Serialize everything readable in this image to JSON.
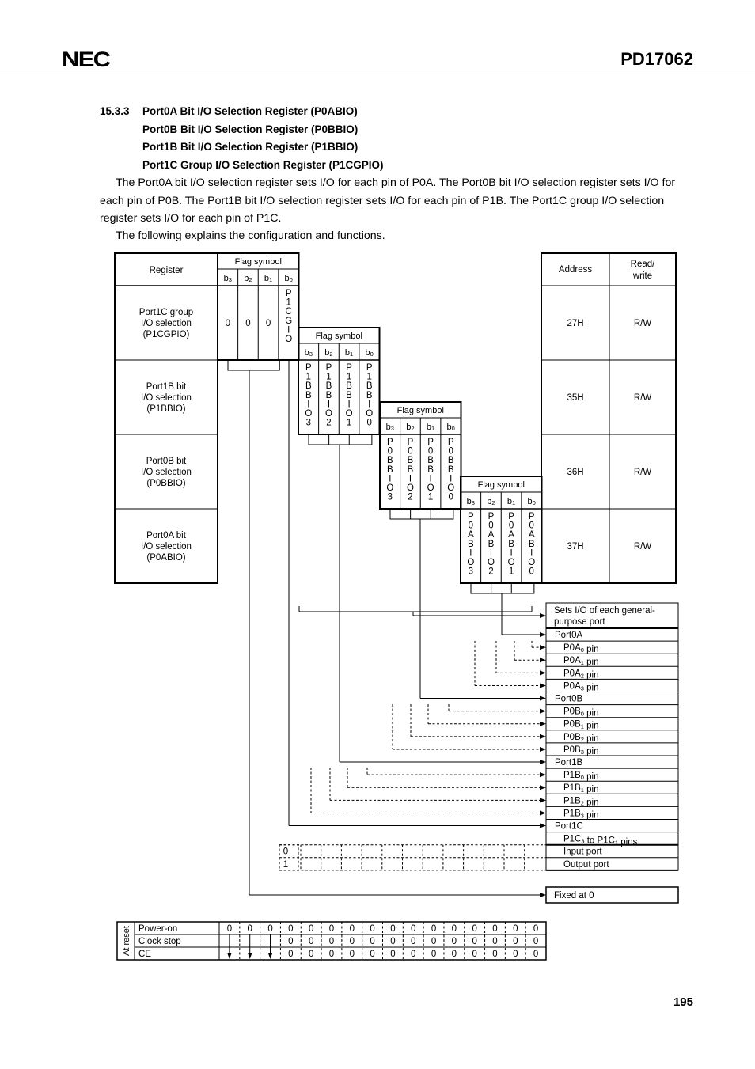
{
  "header": {
    "logo": "NEC",
    "doc_id": "PD17062"
  },
  "section": {
    "number": "15.3.3",
    "titles": [
      "Port0A Bit I/O Selection Register (P0ABIO)",
      "Port0B Bit I/O Selection Register (P0BBIO)",
      "Port1B Bit I/O Selection Register (P1BBIO)",
      "Port1C Group I/O Selection Register (P1CGPIO)"
    ],
    "paragraphs": [
      "The Port0A bit I/O selection register sets I/O for each pin of P0A.  The Port0B bit I/O selection register sets I/O for each pin of P0B.  The Port1B bit I/O selection register sets I/O for each pin of P1B.  The Port1C group I/O selection register sets I/O for each pin of P1C.",
      "The following explains the configuration and functions."
    ]
  },
  "diagram": {
    "register_header": "Register",
    "flag_symbol_header": "Flag symbol",
    "bit_headers": [
      "b3",
      "b2",
      "b1",
      "b0"
    ],
    "address_header": "Address",
    "rw_header": "Read/\nwrite",
    "registers": [
      {
        "name": [
          "Port1C group",
          "I/O selection",
          "(P1CGPIO)"
        ],
        "flags": [
          "0",
          "0",
          "0",
          "P1CGIO"
        ],
        "address": "27H",
        "rw": "R/W"
      },
      {
        "name": [
          "Port1B bit",
          "I/O selection",
          "(P1BBIO)"
        ],
        "flags": [
          "P1BBIO3",
          "P1BBIO2",
          "P1BBIO1",
          "P1BBIO0"
        ],
        "address": "35H",
        "rw": "R/W"
      },
      {
        "name": [
          "Port0B bit",
          "I/O selection",
          "(P0BBIO)"
        ],
        "flags": [
          "P0BBIO3",
          "P0BBIO2",
          "P0BBIO1",
          "P0BBIO0"
        ],
        "address": "36H",
        "rw": "R/W"
      },
      {
        "name": [
          "Port0A bit",
          "I/O selection",
          "(P0ABIO)"
        ],
        "flags": [
          "P0ABIO3",
          "P0ABIO2",
          "P0ABIO1",
          "P0ABIO0"
        ],
        "address": "37H",
        "rw": "R/W"
      }
    ],
    "function_box": {
      "title": [
        "Sets I/O of each general-",
        "purpose port"
      ],
      "rows": [
        {
          "text": "Port0A",
          "indent": false
        },
        {
          "text": "P0A0 pin",
          "indent": true
        },
        {
          "text": "P0A1 pin",
          "indent": true
        },
        {
          "text": "P0A2 pin",
          "indent": true
        },
        {
          "text": "P0A3 pin",
          "indent": true
        },
        {
          "text": "Port0B",
          "indent": false
        },
        {
          "text": "P0B0 pin",
          "indent": true
        },
        {
          "text": "P0B1 pin",
          "indent": true
        },
        {
          "text": "P0B2 pin",
          "indent": true
        },
        {
          "text": "P0B3 pin",
          "indent": true
        },
        {
          "text": "Port1B",
          "indent": false
        },
        {
          "text": "P1B0 pin",
          "indent": true
        },
        {
          "text": "P1B1 pin",
          "indent": true
        },
        {
          "text": "P1B2 pin",
          "indent": true
        },
        {
          "text": "P1B3 pin",
          "indent": true
        },
        {
          "text": "Port1C",
          "indent": false
        },
        {
          "text": "P1C3 to P1C1 pins",
          "indent": true
        }
      ],
      "value_rows": [
        {
          "value": "0",
          "meaning": "Input port"
        },
        {
          "value": "1",
          "meaning": "Output port"
        }
      ],
      "fixed": "Fixed at 0"
    },
    "reset_table": {
      "label": "At reset",
      "rows": [
        {
          "name": "Power-on",
          "values": [
            "0",
            "0",
            "0",
            "0",
            "0",
            "0",
            "0",
            "0",
            "0",
            "0",
            "0",
            "0",
            "0",
            "0",
            "0",
            "0"
          ]
        },
        {
          "name": "Clock stop",
          "values": [
            "",
            "",
            "",
            "0",
            "0",
            "0",
            "0",
            "0",
            "0",
            "0",
            "0",
            "0",
            "0",
            "0",
            "0",
            "0"
          ]
        },
        {
          "name": "CE",
          "values": [
            "",
            "",
            "",
            "0",
            "0",
            "0",
            "0",
            "0",
            "0",
            "0",
            "0",
            "0",
            "0",
            "0",
            "0",
            "0"
          ]
        }
      ]
    }
  },
  "page_number": "195"
}
